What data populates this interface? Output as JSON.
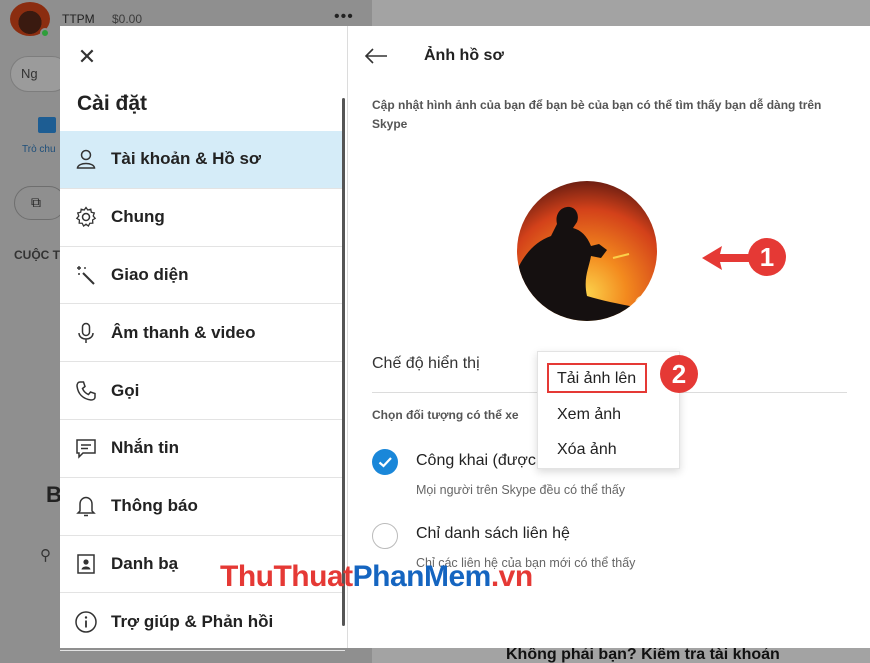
{
  "background": {
    "user_name": "TTPM",
    "credit": "$0.00",
    "more": "•••",
    "search_placeholder": "Ng",
    "chat_label": "Trò chu",
    "recent_label": "CUỘC T",
    "b_letter": "B",
    "bottom_text": "Không phải bạn? Kiểm tra tài khoản"
  },
  "settings": {
    "title": "Cài đặt",
    "nav_items": [
      {
        "label": "Tài khoản & Hồ sơ",
        "icon": "person-icon",
        "active": true
      },
      {
        "label": "Chung",
        "icon": "gear-icon",
        "active": false
      },
      {
        "label": "Giao diện",
        "icon": "magic-wand-icon",
        "active": false
      },
      {
        "label": "Âm thanh & video",
        "icon": "microphone-icon",
        "active": false
      },
      {
        "label": "Gọi",
        "icon": "phone-icon",
        "active": false
      },
      {
        "label": "Nhắn tin",
        "icon": "message-icon",
        "active": false
      },
      {
        "label": "Thông báo",
        "icon": "bell-icon",
        "active": false
      },
      {
        "label": "Danh bạ",
        "icon": "contacts-icon",
        "active": false
      },
      {
        "label": "Trợ giúp & Phản hồi",
        "icon": "info-icon",
        "active": false
      }
    ]
  },
  "profile": {
    "title": "Ảnh hồ sơ",
    "description": "Cập nhật hình ảnh của bạn để bạn bè của bạn có thể tìm thấy bạn dễ dàng trên Skype",
    "display_label": "Chế độ hiển thị",
    "audience_label": "Chọn đối tượng có thể xe",
    "options": [
      {
        "label": "Công khai (được",
        "sub": "Mọi người trên Skype đều có thể thấy",
        "checked": true
      },
      {
        "label": "Chỉ danh sách liên hệ",
        "sub": "Chỉ các liên hệ của bạn mới có thể thấy",
        "checked": false
      }
    ],
    "menu": [
      "Tải ảnh lên",
      "Xem ảnh",
      "Xóa ảnh"
    ]
  },
  "callouts": [
    "1",
    "2"
  ],
  "watermark": {
    "part1": "ThuThuat",
    "part2": "PhanMem",
    "part3": ".vn"
  },
  "colors": {
    "accent": "#1a87d9",
    "active_bg": "#d5ecf8",
    "callout": "#e53935"
  }
}
